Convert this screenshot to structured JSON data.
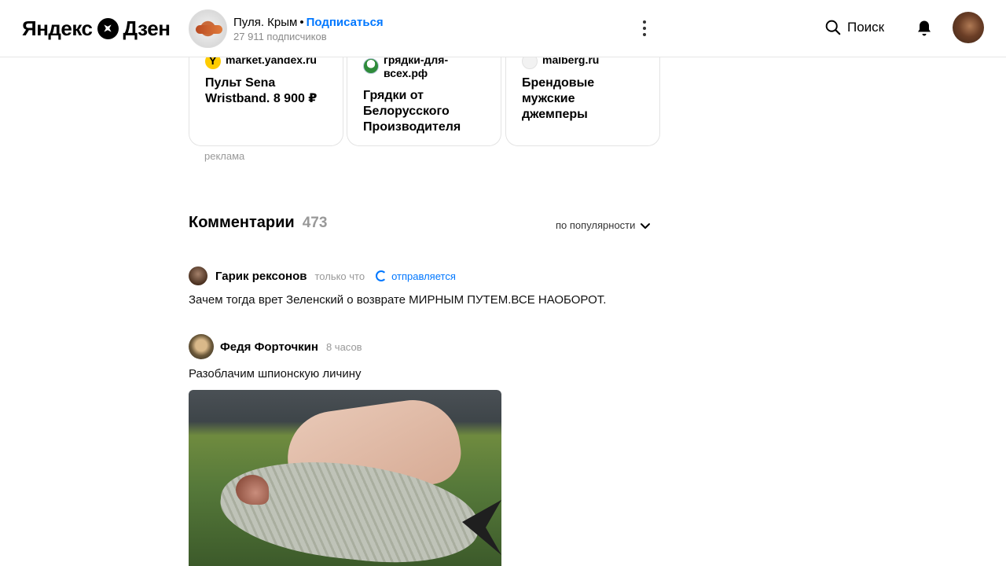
{
  "header": {
    "logo_text": "Яндекс",
    "logo_text2": "Дзен",
    "channel": {
      "name": "Пуля. Крым",
      "separator": "•",
      "subscribe": "Подписаться",
      "subscribers": "27 911 подписчиков"
    },
    "search_label": "Поиск"
  },
  "ads": {
    "label": "реклама",
    "cards": [
      {
        "domain": "market.yandex.ru",
        "title": "Пульт Sena Wristband. 8 900 ₽"
      },
      {
        "domain": "грядки-для-всех.рф",
        "title": "Грядки от Белорусского Производителя"
      },
      {
        "domain": "malberg.ru",
        "title": "Брендовые мужские джемперы"
      }
    ]
  },
  "comments": {
    "title": "Комментарии",
    "count": "473",
    "sort_label": "по популярности",
    "items": [
      {
        "author": "Гарик рексонов",
        "time": "только что",
        "status": "отправляется",
        "text": "Зачем тогда врет Зеленский о возврате МИРНЫМ ПУТЕМ.ВСЕ НАОБОРОТ."
      },
      {
        "author": "Федя Форточкин",
        "time": "8 часов",
        "text": "Разоблачим шпионскую личину"
      }
    ]
  }
}
